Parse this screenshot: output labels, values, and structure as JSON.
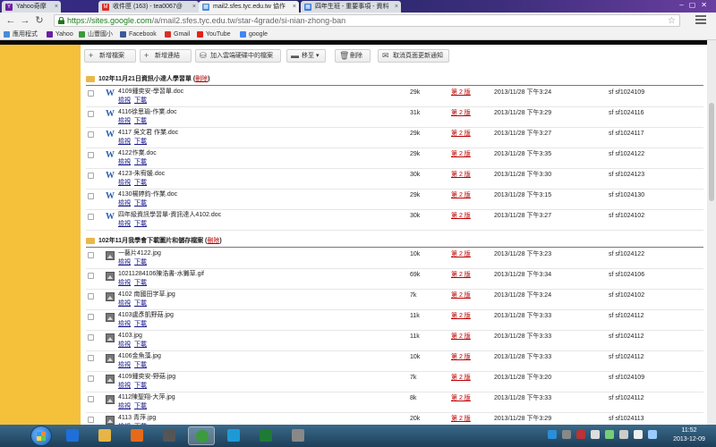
{
  "browser": {
    "tabs": [
      {
        "label": "Yahoo奇摩",
        "fav_color": "#6b1fa0",
        "fav_glyph": "Y"
      },
      {
        "label": "收件匣 (163) - tea0067@",
        "fav_color": "#d93025",
        "fav_glyph": "M"
      },
      {
        "label": "mail2.sfes.tyc.edu.tw 協作",
        "fav_color": "#4a8bd6",
        "fav_glyph": "▦"
      },
      {
        "label": "四年生班 - 重要事項 - 資料",
        "fav_color": "#3b7dd8",
        "fav_glyph": "▦"
      }
    ],
    "url_host": "https://sites.google.com",
    "url_path": "/a/mail2.sfes.tyc.edu.tw/star-4grade/si-nian-zhong-ban",
    "bookmarks": [
      {
        "label": "應用程式",
        "color": "#4a8bd6"
      },
      {
        "label": "Yahoo",
        "color": "#6b1fa0"
      },
      {
        "label": "山豐國小",
        "color": "#3a9a3a"
      },
      {
        "label": "Facebook",
        "color": "#3b5998"
      },
      {
        "label": "Gmail",
        "color": "#d93025"
      },
      {
        "label": "YouTube",
        "color": "#e62117"
      },
      {
        "label": "google",
        "color": "#4285f4"
      }
    ]
  },
  "actions": {
    "add_file": "新增檔案",
    "add_link": "新增連結",
    "add_from_drive": "加入雲端硬碟中的檔案",
    "move_to": "移至",
    "delete": "刪除",
    "unsubscribe": "取消頁面更新通知"
  },
  "sections": [
    {
      "title": "102年11月21日資訊小達人學習單",
      "delete_label": "刪除",
      "files": [
        {
          "name": "4109鍾奕安-學習單.doc",
          "size": "29k",
          "version": "第 2 版",
          "date": "2013/11/28 下午3:24",
          "user": "sf sf1024109",
          "type": "doc"
        },
        {
          "name": "4116徐思瑜-作業.doc",
          "size": "31k",
          "version": "第 2 版",
          "date": "2013/11/28 下午3:29",
          "user": "sf sf1024116",
          "type": "doc"
        },
        {
          "name": "4117 吳文君 作業.doc",
          "size": "29k",
          "version": "第 2 版",
          "date": "2013/11/28 下午3:27",
          "user": "sf sf1024117",
          "type": "doc"
        },
        {
          "name": "4122作業.doc",
          "size": "29k",
          "version": "第 2 版",
          "date": "2013/11/28 下午3:35",
          "user": "sf sf1024122",
          "type": "doc"
        },
        {
          "name": "4123-朱宥媛.doc",
          "size": "30k",
          "version": "第 2 版",
          "date": "2013/11/28 下午3:30",
          "user": "sf sf1024123",
          "type": "doc"
        },
        {
          "name": "4130楊婷鈞-作業.doc",
          "size": "29k",
          "version": "第 2 版",
          "date": "2013/11/28 下午3:15",
          "user": "sf sf1024130",
          "type": "doc"
        },
        {
          "name": "四年級資訊學習單-資訊達人4102.doc",
          "size": "30k",
          "version": "第 2 版",
          "date": "2013/11/28 下午3:27",
          "user": "sf sf1024102",
          "type": "doc"
        }
      ]
    },
    {
      "title": "102年11月我學會下載圖片和儲存檔案",
      "delete_label": "刪除",
      "files": [
        {
          "name": "一藝片4122.jpg",
          "size": "10k",
          "version": "第 2 版",
          "date": "2013/11/28 下午3:23",
          "user": "sf sf1024122",
          "type": "img"
        },
        {
          "name": "1021128410​6陳浩書-水獺草.gif",
          "size": "69k",
          "version": "第 2 版",
          "date": "2013/11/28 下午3:34",
          "user": "sf sf1024106",
          "type": "img"
        },
        {
          "name": "4102 南國田字草.jpg",
          "size": "7k",
          "version": "第 2 版",
          "date": "2013/11/28 下午3:24",
          "user": "sf sf1024102",
          "type": "img"
        },
        {
          "name": "4103盧彥凱野菇.jpg",
          "size": "11k",
          "version": "第 2 版",
          "date": "2013/11/28 下午3:33",
          "user": "sf sf1024112",
          "type": "img"
        },
        {
          "name": "4103.jpg",
          "size": "11k",
          "version": "第 2 版",
          "date": "2013/11/28 下午3:33",
          "user": "sf sf1024112",
          "type": "img"
        },
        {
          "name": "4106金魚藻.jpg",
          "size": "10k",
          "version": "第 2 版",
          "date": "2013/11/28 下午3:33",
          "user": "sf sf1024112",
          "type": "img"
        },
        {
          "name": "4109鍾奕安-野菇.jpg",
          "size": "7k",
          "version": "第 2 版",
          "date": "2013/11/28 下午3:20",
          "user": "sf sf1024109",
          "type": "img"
        },
        {
          "name": "4112陳聖翔-大萍.jpg",
          "size": "8k",
          "version": "第 2 版",
          "date": "2013/11/28 下午3:33",
          "user": "sf sf1024112",
          "type": "img"
        },
        {
          "name": "4113 青萍.jpg",
          "size": "20k",
          "version": "第 2 版",
          "date": "2013/11/28 下午3:29",
          "user": "sf sf1024113",
          "type": "img"
        }
      ]
    }
  ],
  "row_links": {
    "view": "檢視",
    "download": "下載"
  },
  "taskbar": {
    "apps": [
      {
        "color": "#1e6fd9"
      },
      {
        "color": "#e7b545"
      },
      {
        "color": "#e66a1a"
      },
      {
        "color": "#555"
      },
      {
        "color": "#3c9b3c"
      },
      {
        "color": "#1d9ad6"
      },
      {
        "color": "#1e7b34"
      },
      {
        "color": "#888"
      }
    ],
    "time": "11:52",
    "date": "2013-12-09"
  }
}
